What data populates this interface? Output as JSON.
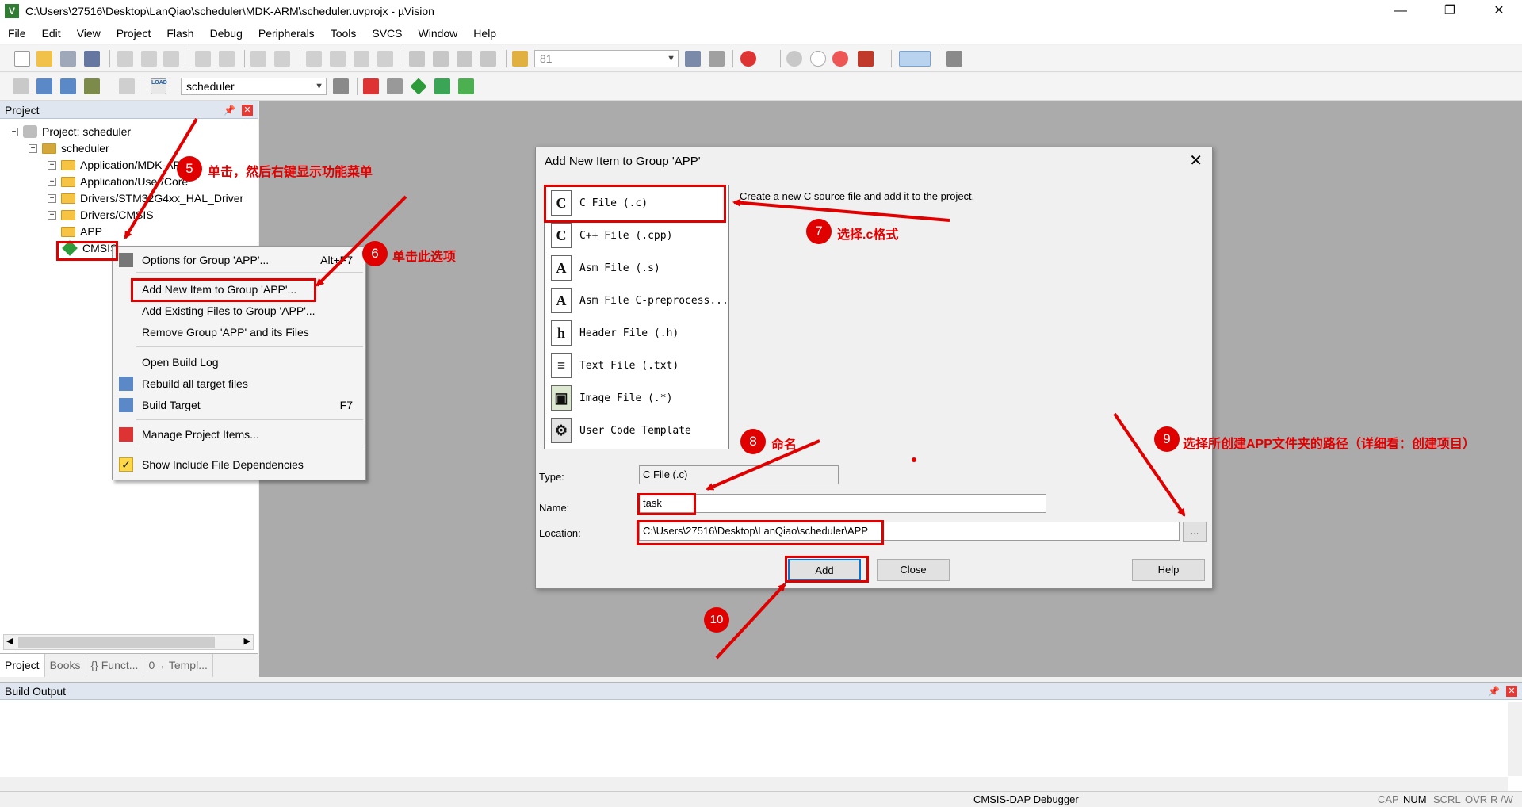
{
  "window": {
    "title": "C:\\Users\\27516\\Desktop\\LanQiao\\scheduler\\MDK-ARM\\scheduler.uvprojx - µVision",
    "icon": "V"
  },
  "menu": [
    "File",
    "Edit",
    "View",
    "Project",
    "Flash",
    "Debug",
    "Peripherals",
    "Tools",
    "SVCS",
    "Window",
    "Help"
  ],
  "toolbar": {
    "find_value": "81",
    "target_select": "scheduler",
    "load_label": "LOAD"
  },
  "project_pane": {
    "title": "Project",
    "tree": {
      "root": "Project: scheduler",
      "target": "scheduler",
      "groups": [
        "Application/MDK-ARM",
        "Application/User/Core",
        "Drivers/STM32G4xx_HAL_Driver",
        "Drivers/CMSIS",
        "APP",
        "CMSIS"
      ]
    },
    "tabs": [
      "Project",
      "Books",
      "{} Funct...",
      "0→ Templ..."
    ]
  },
  "context_menu": {
    "items": [
      {
        "label": "Options for Group 'APP'...",
        "shortcut": "Alt+F7",
        "icon": "options-icon"
      },
      {
        "label": "Add New  Item to Group 'APP'...",
        "shortcut": ""
      },
      {
        "label": "Add Existing Files to Group 'APP'...",
        "shortcut": ""
      },
      {
        "label": "Remove Group 'APP' and its Files",
        "shortcut": ""
      },
      {
        "label": "Open Build Log",
        "shortcut": ""
      },
      {
        "label": "Rebuild all target files",
        "shortcut": "",
        "icon": "rebuild-icon"
      },
      {
        "label": "Build Target",
        "shortcut": "F7",
        "icon": "build-icon"
      },
      {
        "label": "Manage Project Items...",
        "shortcut": "",
        "icon": "manage-icon"
      },
      {
        "label": "Show Include File Dependencies",
        "shortcut": "",
        "icon": "check-icon"
      }
    ]
  },
  "dialog": {
    "title": "Add New Item to Group 'APP'",
    "description": "Create a new C source file and add it to the project.",
    "file_types": [
      {
        "icon": "C",
        "label": "C File (.c)"
      },
      {
        "icon": "C",
        "label": "C++ File (.cpp)"
      },
      {
        "icon": "A",
        "label": "Asm File (.s)"
      },
      {
        "icon": "A",
        "label": "Asm File C-preprocess..."
      },
      {
        "icon": "h",
        "label": "Header File (.h)"
      },
      {
        "icon": "≡",
        "label": "Text File (.txt)"
      },
      {
        "icon": "▣",
        "label": "Image File (.*)"
      },
      {
        "icon": "⚙",
        "label": "User Code Template"
      }
    ],
    "type_label": "Type:",
    "type_value": "C File (.c)",
    "name_label": "Name:",
    "name_value": "task",
    "location_label": "Location:",
    "location_value": "C:\\Users\\27516\\Desktop\\LanQiao\\scheduler\\APP",
    "browse_label": "...",
    "buttons": {
      "add": "Add",
      "close": "Close",
      "help": "Help"
    }
  },
  "build_output": {
    "title": "Build Output"
  },
  "status_bar": {
    "debugger": "CMSIS-DAP Debugger",
    "indicators": [
      "CAP",
      "NUM",
      "SCRL",
      "OVR",
      "R /W"
    ]
  },
  "annotations": [
    {
      "num": "5",
      "text": "单击，然后右键显示功能菜单"
    },
    {
      "num": "6",
      "text": "单击此选项"
    },
    {
      "num": "7",
      "text": "选择.c格式"
    },
    {
      "num": "8",
      "text": "命名"
    },
    {
      "num": "9",
      "text": "选择所创建APP文件夹的路径（详细看：创建项目）"
    },
    {
      "num": "10",
      "text": ""
    }
  ],
  "colors": {
    "annotation_red": "#e00000",
    "workspace_gray": "#ababab",
    "pane_header": "#dfe6f0"
  }
}
